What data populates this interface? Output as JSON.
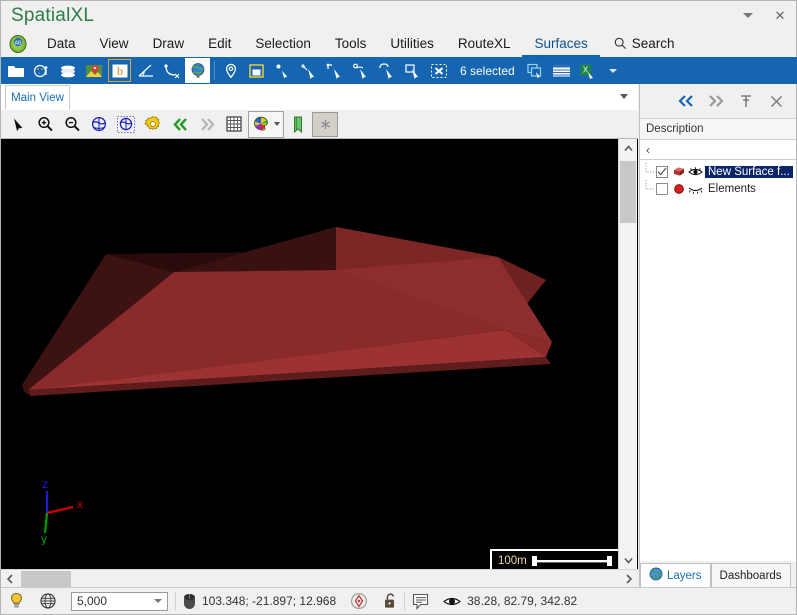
{
  "window": {
    "title": "SpatialXL",
    "buttons": [
      {
        "name": "titlebar-dropdown-button",
        "icon": "chevron-down-icon"
      },
      {
        "name": "titlebar-close-button",
        "icon": "close-icon",
        "glyph": "✕"
      }
    ]
  },
  "menubar": {
    "logo_icon": "app-globe-icon",
    "items": [
      {
        "label": "Data",
        "active": false
      },
      {
        "label": "View",
        "active": false
      },
      {
        "label": "Draw",
        "active": false
      },
      {
        "label": "Edit",
        "active": false
      },
      {
        "label": "Selection",
        "active": false
      },
      {
        "label": "Tools",
        "active": false
      },
      {
        "label": "Utilities",
        "active": false
      },
      {
        "label": "RouteXL",
        "active": false
      },
      {
        "label": "Surfaces",
        "active": true
      }
    ],
    "search": {
      "label": "Search",
      "icon": "search-icon"
    }
  },
  "toolbar": {
    "selection_label": "6 selected",
    "icons": [
      "open-folder-icon",
      "palette-settings-icon",
      "layers-stack-icon",
      "map-pin-image-icon",
      "b-symbol-icon",
      "measure-angle-icon",
      "curve-tool-icon",
      "globe-icon",
      "location-pin-icon",
      "frame-select-icon",
      "pointer-node-icon",
      "transform-node-icon",
      "add-node-icon",
      "select-node-icon",
      "lasso-select-icon",
      "crop-select-icon",
      "clear-selection-icon",
      "copy-to-view-icon",
      "table-grid-icon",
      "excel-export-icon",
      "overflow-caret-icon"
    ]
  },
  "view_tabs": {
    "tabs": [
      {
        "label": "Main View",
        "active": true
      }
    ],
    "overflow_icon": "chevron-down-icon"
  },
  "view_toolbar": {
    "icons": [
      "arrow-select-icon",
      "zoom-in-icon",
      "zoom-out-icon",
      "zoom-extents-globe-icon",
      "zoom-selected-globe-icon",
      "view-settings-gear-icon",
      "rewind-icon",
      "forward-icon",
      "grid-icon",
      "color-palette-icon",
      "bookmark-flag-icon",
      "snapshot-icon"
    ]
  },
  "viewport": {
    "background_color": "#000000",
    "surface_color": "#8f2b2b",
    "axis_gizmo": {
      "x": {
        "label": "x",
        "color": "#d00000"
      },
      "y": {
        "label": "y",
        "color": "#00a000"
      },
      "z": {
        "label": "z",
        "color": "#1b1bd0"
      }
    },
    "scalebar": {
      "label": "100m"
    },
    "scrollbars": {
      "vertical": {
        "up_glyph": "⌃",
        "down_glyph": "⌄"
      },
      "horizontal": {
        "left_glyph": "‹",
        "right_glyph": "›"
      }
    }
  },
  "right_panel": {
    "tools": [
      {
        "name": "collapse-left-button",
        "icon": "double-chevron-left-icon"
      },
      {
        "name": "expand-right-button",
        "icon": "double-chevron-right-icon"
      },
      {
        "name": "pin-panel-button",
        "icon": "pin-icon"
      },
      {
        "name": "close-panel-button",
        "icon": "close-icon",
        "glyph": "✕"
      }
    ],
    "column_header": "Description",
    "filter_glyph": "‹",
    "tree": [
      {
        "label": "New Surface f...",
        "checked": true,
        "selected": true,
        "type_icon": "red-surface-box-icon",
        "visibility_icon": "eye-open-icon",
        "visible": true
      },
      {
        "label": "Elements",
        "checked": false,
        "selected": false,
        "type_icon": "red-circle-icon",
        "visibility_icon": "eye-closed-icon",
        "visible": false
      }
    ],
    "tabs": [
      {
        "label": "Layers",
        "active": true,
        "icon": "globe-icon"
      },
      {
        "label": "Dashboards",
        "active": false
      }
    ]
  },
  "statusbar": {
    "lightbulb_icon": "lightbulb-icon",
    "globe_wire_icon": "wireframe-globe-icon",
    "scale_value": "5,000",
    "mouse_icon": "mouse-icon",
    "coordinates": "103.348; -21.897; 12.968",
    "target_icon": "target-marker-icon",
    "lock_icon": "unlocked-padlock-icon",
    "note_icon": "note-icon",
    "eye_icon": "eye-icon",
    "camera_position": "38.28, 82.79, 342.82"
  },
  "colors": {
    "toolbar_blue": "#1565b0",
    "accent_blue": "#1a6fb5",
    "title_green": "#2d7d46",
    "selection_navy": "#0a246a",
    "panel_gray": "#f0f0f0"
  }
}
